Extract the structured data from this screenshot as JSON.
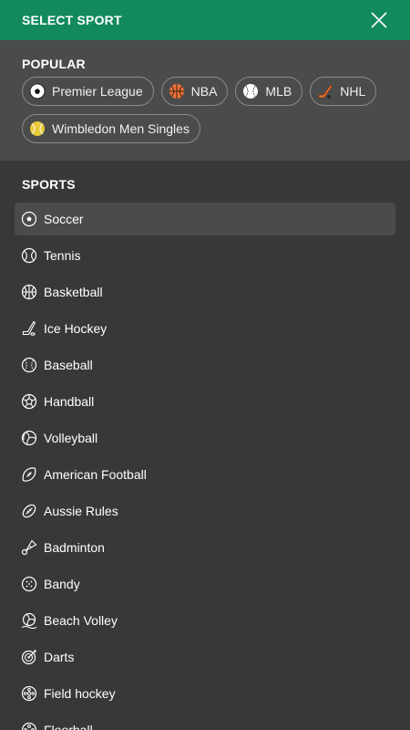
{
  "header": {
    "title": "SELECT SPORT",
    "close_icon": "close-icon"
  },
  "popular": {
    "title": "POPULAR",
    "chips": [
      {
        "label": "Premier League",
        "icon": "soccer-ball-icon"
      },
      {
        "label": "NBA",
        "icon": "basketball-icon"
      },
      {
        "label": "MLB",
        "icon": "baseball-icon"
      },
      {
        "label": "NHL",
        "icon": "hockey-stick-icon"
      },
      {
        "label": "Wimbledon Men Singles",
        "icon": "tennis-ball-icon"
      }
    ]
  },
  "sports": {
    "title": "SPORTS",
    "selected": "Soccer",
    "items": [
      {
        "label": "Soccer",
        "icon": "soccer-icon"
      },
      {
        "label": "Tennis",
        "icon": "tennis-icon"
      },
      {
        "label": "Basketball",
        "icon": "basketball-icon"
      },
      {
        "label": "Ice Hockey",
        "icon": "ice-hockey-icon"
      },
      {
        "label": "Baseball",
        "icon": "baseball-icon"
      },
      {
        "label": "Handball",
        "icon": "handball-icon"
      },
      {
        "label": "Volleyball",
        "icon": "volleyball-icon"
      },
      {
        "label": "American Football",
        "icon": "american-football-icon"
      },
      {
        "label": "Aussie Rules",
        "icon": "aussie-rules-icon"
      },
      {
        "label": "Badminton",
        "icon": "shuttlecock-icon"
      },
      {
        "label": "Bandy",
        "icon": "bandy-icon"
      },
      {
        "label": "Beach Volley",
        "icon": "beach-volley-icon"
      },
      {
        "label": "Darts",
        "icon": "dart-board-icon"
      },
      {
        "label": "Field hockey",
        "icon": "field-hockey-icon"
      },
      {
        "label": "Floorball",
        "icon": "floorball-icon"
      }
    ]
  },
  "colors": {
    "header": "#138a5e",
    "popular_bg": "#4a4b4b",
    "body_bg": "#383838",
    "chip_border": "#8a8a8a"
  }
}
